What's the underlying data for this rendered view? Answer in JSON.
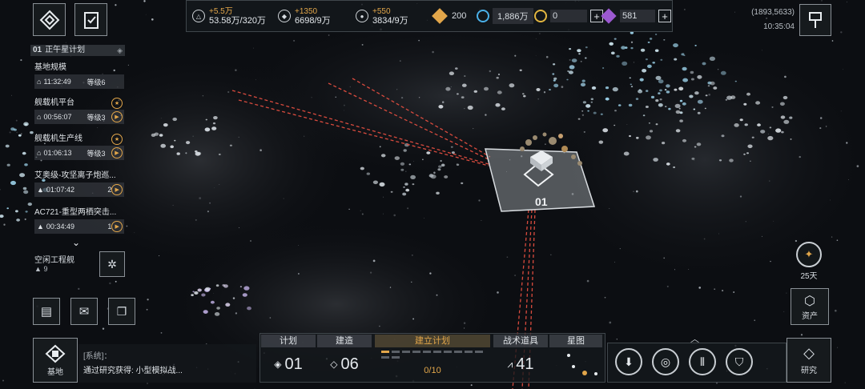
{
  "topbar": {
    "resources": [
      {
        "icon": "triangle-resource-icon",
        "gain": "+5.5万",
        "amount": "53.58万/320万"
      },
      {
        "icon": "crystal-resource-icon",
        "gain": "+1350",
        "amount": "6698/9万"
      },
      {
        "icon": "gas-resource-icon",
        "gain": "+550",
        "amount": "3834/9万"
      }
    ],
    "currencies": [
      {
        "icon": "orange-diamond-icon",
        "value": "200"
      },
      {
        "icon": "blue-g-coin-icon",
        "value": "1,886万"
      },
      {
        "icon": "gold-coin-icon",
        "value": "0"
      },
      {
        "icon": "purple-p-coin-icon",
        "value": "581"
      }
    ],
    "coordinates": "(1893,5633)",
    "time": "10:35:04"
  },
  "queue": {
    "header_num": "01",
    "header_title": "正午星计划",
    "items": [
      {
        "title": "基地规模",
        "timer": "11:32:49",
        "level": "等级6"
      },
      {
        "title": "舰载机平台",
        "timer": "00:56:07",
        "level": "等级3"
      },
      {
        "title": "舰载机生产线",
        "timer": "01:06:13",
        "level": "等级3"
      },
      {
        "title": "艾奥级-攻坚离子炮巡...",
        "timer": "01:07:42",
        "level": "2"
      },
      {
        "title": "AC721-重型两栖突击...",
        "timer": "00:34:49",
        "level": "1"
      }
    ],
    "idle_label": "空闲工程舰",
    "idle_count": "9"
  },
  "map": {
    "base_label": "01"
  },
  "chat": {
    "base_label": "基地",
    "system_tag": "[系统]：",
    "message": "通过研究获得: 小型模拟战..."
  },
  "bottom_tabs": [
    {
      "label": "计划",
      "value": "01"
    },
    {
      "label": "建造",
      "value": "06"
    },
    {
      "label": "建立计划",
      "value": "0/10"
    },
    {
      "label": "战术道具",
      "value": "41"
    },
    {
      "label": "星图",
      "value": ""
    }
  ],
  "right": {
    "days_label": "25天",
    "assets_label": "资产",
    "research_label": "研究"
  },
  "colors": {
    "accent_orange": "#e2a64a",
    "laser_red": "#d94b3e",
    "panel_border": "#8a9096"
  }
}
